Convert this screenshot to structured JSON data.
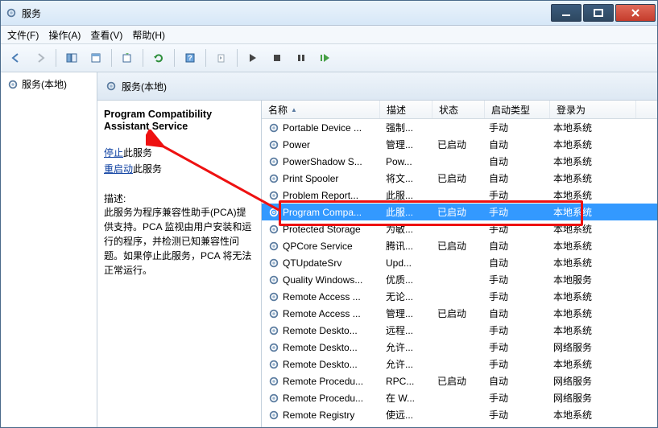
{
  "window": {
    "title": "服务"
  },
  "menu": {
    "file": "文件(F)",
    "action": "操作(A)",
    "view": "查看(V)",
    "help": "帮助(H)"
  },
  "left": {
    "root": "服务(本地)"
  },
  "header": {
    "title": "服务(本地)"
  },
  "detail": {
    "title": "Program Compatibility Assistant Service",
    "stop_link": "停止",
    "stop_suffix": "此服务",
    "restart_link": "重启动",
    "restart_suffix": "此服务",
    "desc_label": "描述:",
    "desc": "此服务为程序兼容性助手(PCA)提供支持。PCA 监视由用户安装和运行的程序，并检测已知兼容性问题。如果停止此服务，PCA 将无法正常运行。"
  },
  "columns": {
    "name": "名称",
    "desc": "描述",
    "status": "状态",
    "start": "启动类型",
    "logon": "登录为"
  },
  "rows": [
    {
      "name": "Portable Device ...",
      "desc": "强制...",
      "status": "",
      "start": "手动",
      "logon": "本地系统"
    },
    {
      "name": "Power",
      "desc": "管理...",
      "status": "已启动",
      "start": "自动",
      "logon": "本地系统"
    },
    {
      "name": "PowerShadow S...",
      "desc": "Pow...",
      "status": "",
      "start": "自动",
      "logon": "本地系统"
    },
    {
      "name": "Print Spooler",
      "desc": "将文...",
      "status": "已启动",
      "start": "自动",
      "logon": "本地系统"
    },
    {
      "name": "Problem Report...",
      "desc": "此服...",
      "status": "",
      "start": "手动",
      "logon": "本地系统"
    },
    {
      "name": "Program Compa...",
      "desc": "此服...",
      "status": "已启动",
      "start": "手动",
      "logon": "本地系统",
      "selected": true
    },
    {
      "name": "Protected Storage",
      "desc": "为敏...",
      "status": "",
      "start": "手动",
      "logon": "本地系统"
    },
    {
      "name": "QPCore Service",
      "desc": "腾讯...",
      "status": "已启动",
      "start": "自动",
      "logon": "本地系统"
    },
    {
      "name": "QTUpdateSrv",
      "desc": "Upd...",
      "status": "",
      "start": "自动",
      "logon": "本地系统"
    },
    {
      "name": "Quality Windows...",
      "desc": "优质...",
      "status": "",
      "start": "手动",
      "logon": "本地服务"
    },
    {
      "name": "Remote Access ...",
      "desc": "无论...",
      "status": "",
      "start": "手动",
      "logon": "本地系统"
    },
    {
      "name": "Remote Access ...",
      "desc": "管理...",
      "status": "已启动",
      "start": "自动",
      "logon": "本地系统"
    },
    {
      "name": "Remote Deskto...",
      "desc": "远程...",
      "status": "",
      "start": "手动",
      "logon": "本地系统"
    },
    {
      "name": "Remote Deskto...",
      "desc": "允许...",
      "status": "",
      "start": "手动",
      "logon": "网络服务"
    },
    {
      "name": "Remote Deskto...",
      "desc": "允许...",
      "status": "",
      "start": "手动",
      "logon": "本地系统"
    },
    {
      "name": "Remote Procedu...",
      "desc": "RPC...",
      "status": "已启动",
      "start": "自动",
      "logon": "网络服务"
    },
    {
      "name": "Remote Procedu...",
      "desc": "在 W...",
      "status": "",
      "start": "手动",
      "logon": "网络服务"
    },
    {
      "name": "Remote Registry",
      "desc": "使远...",
      "status": "",
      "start": "手动",
      "logon": "本地系统"
    }
  ]
}
